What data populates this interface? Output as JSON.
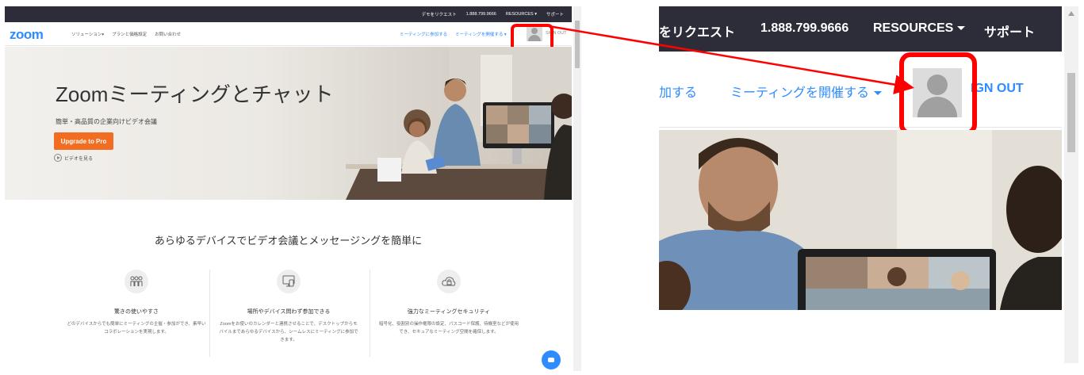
{
  "zoom_page": {
    "topbar": {
      "request_demo": "デモをリクエスト",
      "phone": "1.888.799.9666",
      "resources": "RESOURCES ▾",
      "support": "サポート"
    },
    "navbar": {
      "logo": "zoom",
      "solutions": "ソリューション▾",
      "plans": "プランと価格設定",
      "contact": "お問い合わせ",
      "join_meeting": "ミーティングに参加する",
      "host_meeting": "ミーティングを開催する ▾",
      "sign_out": "SIGN OUT"
    },
    "hero": {
      "title": "Zoomミーティングとチャット",
      "subtitle": "簡単・高品質の企業向けビデオ会議",
      "upgrade_button": "Upgrade to Pro",
      "watch_video": "ビデオを見る"
    },
    "section_title": "あらゆるデバイスでビデオ会議とメッセージングを簡単に",
    "features": [
      {
        "icon": "people-icon",
        "title": "驚きの使いやすさ",
        "description": "どのデバイスからでも簡単にミーティングの主催・参加ができ、素早いコラボレーションを実現します。"
      },
      {
        "icon": "devices-icon",
        "title": "場所やデバイス問わず参加できる",
        "description": "Zoomをお使いのカレンダーと連携させることで、デスクトップからモバイルまであらゆるデバイスから、シームレスにミーティングに参加できます。"
      },
      {
        "icon": "cloud-lock-icon",
        "title": "強力なミーティングセキュリティ",
        "description": "暗号化、役割別の操作権限の設定、パスコード保護、待機室などが使用でき、セキュアなミーティング空間を確保します。"
      }
    ]
  },
  "zoomed_view": {
    "request_demo_partial": "をリクエスト",
    "phone": "1.888.799.9666",
    "resources": "RESOURCES",
    "support": "サポート",
    "join_partial": "加する",
    "host_meeting": "ミーティングを開催する",
    "sign_out_partial": "IGN OUT"
  },
  "colors": {
    "zoom_blue": "#2d8cff",
    "topbar_bg": "#2d2d3a",
    "upgrade_orange": "#f26d21",
    "highlight_red": "#ff0000"
  }
}
